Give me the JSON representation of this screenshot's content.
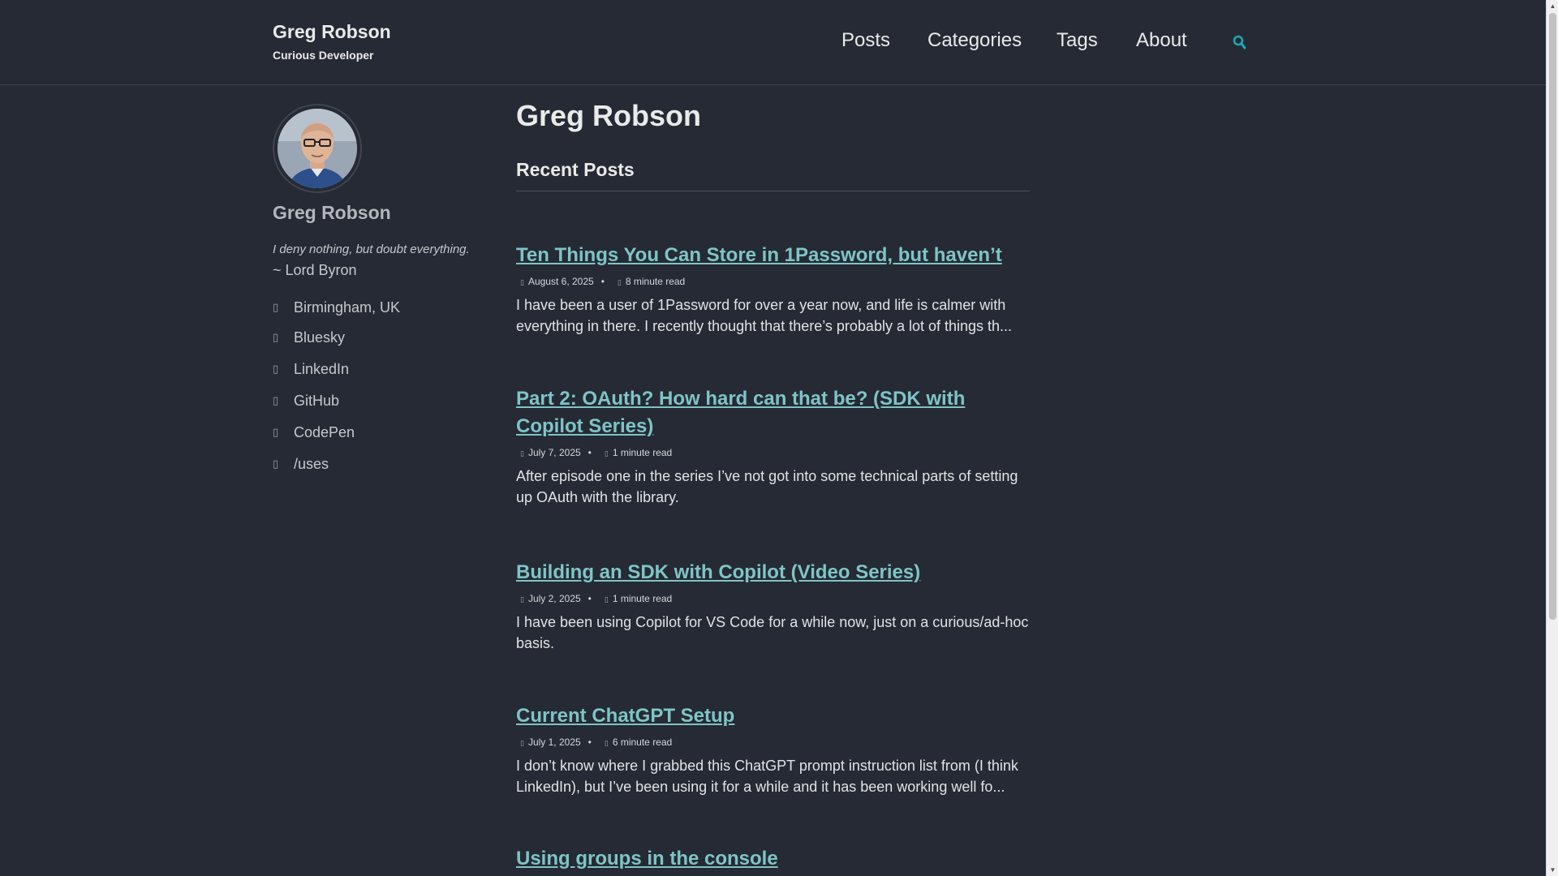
{
  "header": {
    "site_title": "Greg Robson",
    "site_subtitle": "Curious Developer",
    "nav": [
      "Posts",
      "Categories",
      "Tags",
      "About"
    ],
    "search_icon": "search-icon"
  },
  "sidebar": {
    "author_name": "Greg Robson",
    "bio_quote": "I deny nothing, but doubt everything.",
    "bio_signature": "~ Lord Byron",
    "links": [
      {
        "label": "Birmingham, UK",
        "icon": "map-marker-icon"
      },
      {
        "label": "Bluesky",
        "icon": "bluesky-icon"
      },
      {
        "label": "LinkedIn",
        "icon": "linkedin-icon"
      },
      {
        "label": "GitHub",
        "icon": "github-icon"
      },
      {
        "label": "CodePen",
        "icon": "codepen-icon"
      },
      {
        "label": "/uses",
        "icon": "link-icon"
      }
    ]
  },
  "main": {
    "page_title": "Greg Robson",
    "section_title": "Recent Posts",
    "posts": [
      {
        "title": "Ten Things You Can Store in 1Password, but haven’t",
        "date": "August 6, 2025",
        "read_time": "8 minute read",
        "excerpt": "I have been a user of 1Password for over a year now, and life is calmer with everything in there. I recently thought that there’s probably a lot of things th..."
      },
      {
        "title": "Part 2: OAuth? How hard can that be? (SDK with Copilot Series)",
        "date": "July 7, 2025",
        "read_time": "1 minute read",
        "excerpt": "After episode one in the series I’ve not got into some technical parts of setting up OAuth with the library."
      },
      {
        "title": "Building an SDK with Copilot (Video Series)",
        "date": "July 2, 2025",
        "read_time": "1 minute read",
        "excerpt": "I have been using Copilot for VS Code for a while now, just on a curious/ad-hoc basis."
      },
      {
        "title": "Current ChatGPT Setup",
        "date": "July 1, 2025",
        "read_time": "6 minute read",
        "excerpt": "I don’t know where I grabbed this ChatGPT prompt instruction list from (I think LinkedIn), but I’ve been using it for a while and it has been working well fo..."
      },
      {
        "title": "Using groups in the console"
      }
    ]
  },
  "colors": {
    "background": "#252a34",
    "link": "#7fc4c6",
    "accent": "#1ea7b5"
  }
}
